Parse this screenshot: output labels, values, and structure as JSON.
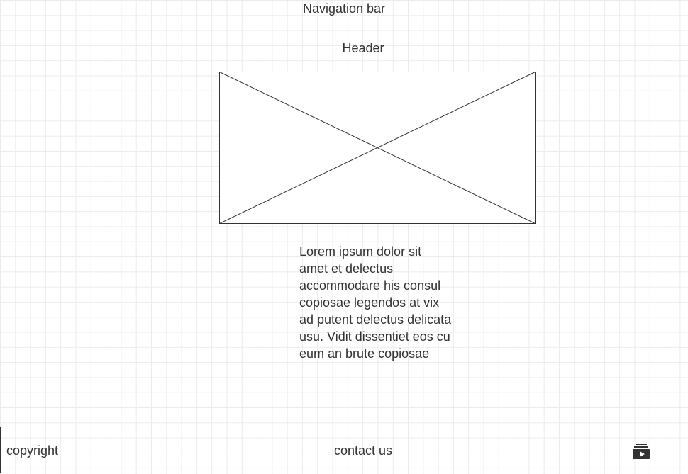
{
  "navigation": {
    "label": "Navigation bar"
  },
  "header": {
    "label": "Header"
  },
  "image_placeholder": {
    "icon": "image-placeholder-x"
  },
  "content": {
    "paragraph": "Lorem ipsum dolor sit amet et delectus accommodare his consul copiosae legendos at vix ad putent delectus delicata usu. Vidit dissentiet eos cu eum an brute copiosae"
  },
  "footer": {
    "copyright": "copyright",
    "contact": "contact us",
    "icon": "video-playlist-icon"
  },
  "colors": {
    "text": "#333333",
    "grid": "#ececec",
    "border": "#333333",
    "background": "#ffffff"
  }
}
